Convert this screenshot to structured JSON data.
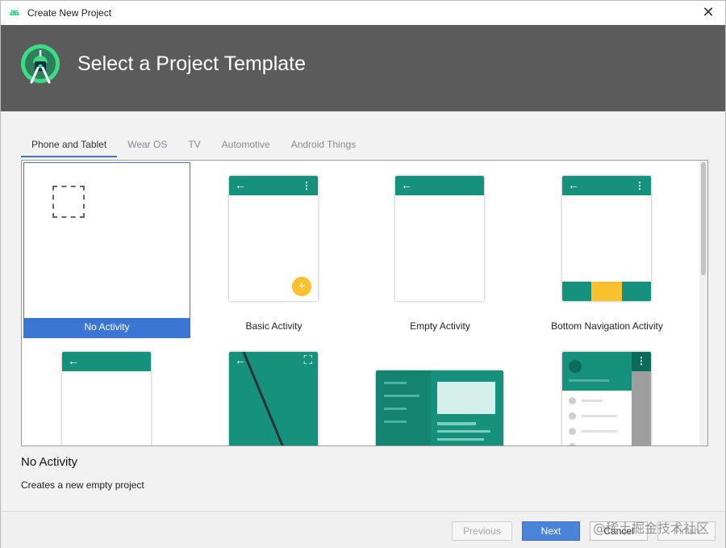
{
  "window": {
    "title": "Create New Project",
    "close_glyph": "✕"
  },
  "header": {
    "title": "Select a Project Template",
    "logo_icon": "android-studio-logo"
  },
  "tabs": [
    {
      "label": "Phone and Tablet",
      "active": true
    },
    {
      "label": "Wear OS",
      "active": false
    },
    {
      "label": "TV",
      "active": false
    },
    {
      "label": "Automotive",
      "active": false
    },
    {
      "label": "Android Things",
      "active": false
    }
  ],
  "templates": [
    {
      "label": "No Activity",
      "selected": true
    },
    {
      "label": "Basic Activity",
      "selected": false
    },
    {
      "label": "Empty Activity",
      "selected": false
    },
    {
      "label": "Bottom Navigation Activity",
      "selected": false
    }
  ],
  "glyphs": {
    "back": "←",
    "menu": "⋮",
    "fab": "+",
    "fullscreen": "⛶"
  },
  "detail": {
    "title": "No Activity",
    "description": "Creates a new empty project"
  },
  "buttons": {
    "previous": "Previous",
    "next": "Next",
    "cancel": "Cancel",
    "finish": "Finish"
  },
  "watermark": "@稀土掘金技术社区",
  "colors": {
    "header_bg": "#5b5b5b",
    "accent": "#3b76d4",
    "teal": "#16917e",
    "amber": "#fbc02d"
  }
}
